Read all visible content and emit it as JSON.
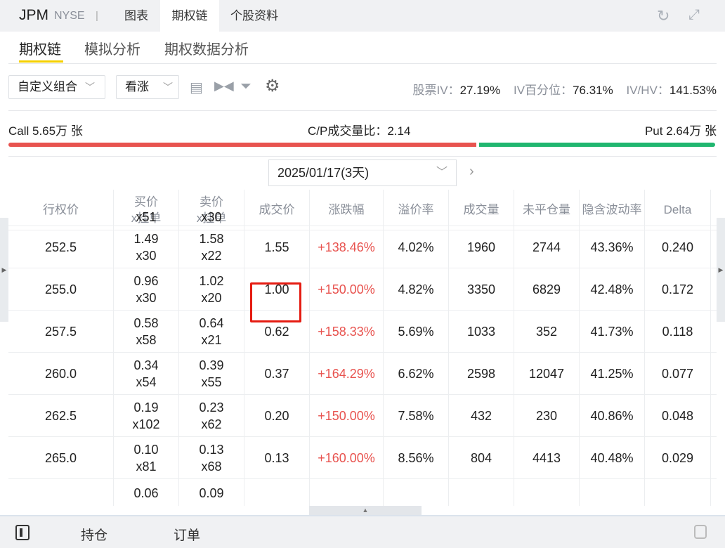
{
  "header": {
    "ticker": "JPM",
    "exchange": "NYSE",
    "separator": "|",
    "tabs": [
      {
        "label": "图表"
      },
      {
        "label": "期权链"
      },
      {
        "label": "个股资料"
      }
    ]
  },
  "subtabs": [
    {
      "label": "期权链"
    },
    {
      "label": "模拟分析"
    },
    {
      "label": "期权数据分析"
    }
  ],
  "toolbar": {
    "strategy": "自定义组合",
    "direction": "看涨"
  },
  "stats": {
    "stock_iv_label": "股票IV：",
    "stock_iv": "27.19%",
    "iv_pct_label": "IV百分位：",
    "iv_pct": "76.31%",
    "ivhv_label": "IV/HV：",
    "ivhv": "141.53%"
  },
  "volume": {
    "call": "Call 5.65万 张",
    "ratio": "C/P成交量比：2.14",
    "put": "Put 2.64万 张",
    "call_fraction": 0.68
  },
  "expiry": {
    "date": "2025/01/17(3天)"
  },
  "table": {
    "columns": [
      [
        "行权价"
      ],
      [
        "买价",
        "x挂单"
      ],
      [
        "卖价",
        "x挂单"
      ],
      [
        "成交价"
      ],
      [
        "涨跌幅"
      ],
      [
        "溢价率"
      ],
      [
        "成交量"
      ],
      [
        "未平仓量"
      ],
      [
        "隐含波动率"
      ],
      [
        "Delta"
      ]
    ],
    "partial_top": {
      "bid_size": "x51",
      "ask_size": "x30"
    },
    "rows": [
      {
        "strike": "252.5",
        "bid": "1.49",
        "bid_size": "x30",
        "ask": "1.58",
        "ask_size": "x22",
        "last": "1.55",
        "change": "+138.46%",
        "premium": "4.02%",
        "volume": "1960",
        "oi": "2744",
        "iv": "43.36%",
        "delta": "0.240"
      },
      {
        "strike": "255.0",
        "bid": "0.96",
        "bid_size": "x30",
        "ask": "1.02",
        "ask_size": "x20",
        "last": "1.00",
        "change": "+150.00%",
        "premium": "4.82%",
        "volume": "3350",
        "oi": "6829",
        "iv": "42.48%",
        "delta": "0.172"
      },
      {
        "strike": "257.5",
        "bid": "0.58",
        "bid_size": "x58",
        "ask": "0.64",
        "ask_size": "x21",
        "last": "0.62",
        "change": "+158.33%",
        "premium": "5.69%",
        "volume": "1033",
        "oi": "352",
        "iv": "41.73%",
        "delta": "0.118"
      },
      {
        "strike": "260.0",
        "bid": "0.34",
        "bid_size": "x54",
        "ask": "0.39",
        "ask_size": "x55",
        "last": "0.37",
        "change": "+164.29%",
        "premium": "6.62%",
        "volume": "2598",
        "oi": "12047",
        "iv": "41.25%",
        "delta": "0.077"
      },
      {
        "strike": "262.5",
        "bid": "0.19",
        "bid_size": "x102",
        "ask": "0.23",
        "ask_size": "x62",
        "last": "0.20",
        "change": "+150.00%",
        "premium": "7.58%",
        "volume": "432",
        "oi": "230",
        "iv": "40.86%",
        "delta": "0.048"
      },
      {
        "strike": "265.0",
        "bid": "0.10",
        "bid_size": "x81",
        "ask": "0.13",
        "ask_size": "x68",
        "last": "0.13",
        "change": "+160.00%",
        "premium": "8.56%",
        "volume": "804",
        "oi": "4413",
        "iv": "40.48%",
        "delta": "0.029"
      }
    ],
    "partial_bottom": {
      "bid": "0.06",
      "ask": "0.09"
    }
  },
  "footer": {
    "positions": "持仓",
    "orders": "订单"
  },
  "colors": {
    "accent": "#f5d000",
    "up": "#e8534f",
    "down": "#20b66f"
  }
}
